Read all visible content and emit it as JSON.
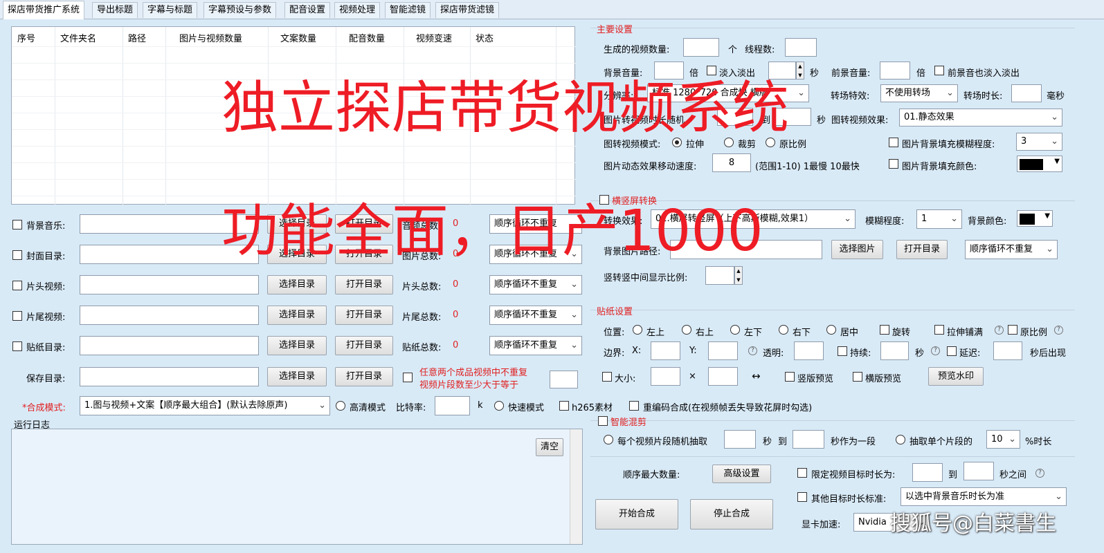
{
  "tabs": [
    "探店带货推广系统",
    "导出标题",
    "字幕与标题",
    "字幕预设与参数",
    "配音设置",
    "视频处理",
    "智能滤镜",
    "探店带货滤镜"
  ],
  "table": {
    "columns": [
      "序号",
      "文件夹名",
      "路径",
      "图片与视频数量",
      "文案数量",
      "配音数量",
      "视频变速",
      "状态"
    ]
  },
  "rows": [
    {
      "label": "背景音乐:",
      "has_cb": true,
      "btn1": "选择目录",
      "btn2": "打开目录",
      "count_label": "音频总数:",
      "count": "0",
      "mode": "顺序循环不重复"
    },
    {
      "label": "封面目录:",
      "has_cb": true,
      "btn1": "选择目录",
      "btn2": "打开目录",
      "count_label": "图片总数:",
      "count": "0",
      "mode": "顺序循环不重复"
    },
    {
      "label": "片头视频:",
      "has_cb": true,
      "btn1": "选择目录",
      "btn2": "打开目录",
      "count_label": "片头总数:",
      "count": "0",
      "mode": "顺序循环不重复"
    },
    {
      "label": "片尾视频:",
      "has_cb": true,
      "btn1": "选择目录",
      "btn2": "打开目录",
      "count_label": "片尾总数:",
      "count": "0",
      "mode": "顺序循环不重复"
    },
    {
      "label": "贴纸目录:",
      "has_cb": true,
      "btn1": "选择目录",
      "btn2": "打开目录",
      "count_label": "贴纸总数:",
      "count": "0",
      "mode": "顺序循环不重复"
    }
  ],
  "save": {
    "label": "保存目录:",
    "btn1": "选择目录",
    "btn2": "打开目录",
    "note1": "任意两个成品视频中不重复",
    "note2": "视频片段数至少大于等于"
  },
  "compose": {
    "label": "*合成模式:",
    "mode": "1.图与视频+文案【顺序最大组合】(默认去除原声)",
    "hd": "高清模式",
    "bitrate": "比特率:",
    "k": "k",
    "fast": "快速模式",
    "h265": "h265素材",
    "reencode": "重编码合成(在视频帧丢失导致花屏时勾选)"
  },
  "log": {
    "title": "运行日志",
    "clear": "清空"
  },
  "main": {
    "title": "主要设置",
    "gen_count": "生成的视频数量:",
    "unit_ge": "个",
    "threads": "线程数:",
    "bg_vol": "背景音量:",
    "bei": "倍",
    "fade": "淡入淡出",
    "sec": "秒",
    "fg_vol": "前景音量:",
    "bei2": "倍",
    "fg_fade": "前景音也淡入淡出",
    "res_label": "分辨率:",
    "res": "标准 1280*720 合成快 横版",
    "trans_label": "转场特效:",
    "trans": "不使用转场",
    "trans_dur": "转场时长:",
    "ms": "毫秒",
    "img_dur": "图片转视频时长随机",
    "to": "到",
    "sec2": "秒",
    "img_fx_label": "图转视频效果:",
    "img_fx": "01.静态效果",
    "img_mode": "图转视频模式:",
    "stretch": "拉伸",
    "crop": "裁剪",
    "orig": "原比例",
    "blur_fill": "图片背景填充模糊程度:",
    "blur_val": "3",
    "speed_label": "图片动态效果移动速度:",
    "speed": "8",
    "speed_note": "(范围1-10) 1最慢 10最快",
    "color_fill": "图片背景填充颜色:"
  },
  "flip": {
    "title": "横竖屏转换",
    "effect_label": "转换效果:",
    "effect": "01.横屏转竖屏（上下高斯模糊,效果1）",
    "blur_label": "模糊程度:",
    "blur": "1",
    "bg_color": "背景颜色:",
    "bg_path": "背景图片路径:",
    "select_img": "选择图片",
    "open_dir": "打开目录",
    "loop": "顺序循环不重复",
    "ratio": "竖转竖中间显示比例:"
  },
  "sticker": {
    "title": "贴纸设置",
    "pos": "位置:",
    "tl": "左上",
    "tr": "右上",
    "bl": "左下",
    "br": "右下",
    "center": "居中",
    "rotate": "旋转",
    "tile": "拉伸铺满",
    "orig": "原比例",
    "margin": "边界:",
    "x": "X:",
    "y": "Y:",
    "alpha": "透明:",
    "dur": "持续:",
    "sec": "秒",
    "delay": "延迟:",
    "after": "秒后出现",
    "size": "大小:",
    "times": "×",
    "arrow": "↔",
    "v_preview": "竖版预览",
    "h_preview": "横版预览",
    "wm_preview": "预览水印"
  },
  "smart": {
    "title": "智能混剪",
    "each": "每个视频片段随机抽取",
    "sec": "秒",
    "to": "到",
    "as_seg": "秒作为一段",
    "single": "抽取单个片段的",
    "pct": "10",
    "pct_label": "%时长"
  },
  "bottom": {
    "max_seq": "顺序最大数量:",
    "advanced": "高级设置",
    "limit": "限定视频目标时长为:",
    "to": "到",
    "between": "秒之间",
    "other": "其他目标时长标准:",
    "other_sel": "以选中背景音乐时长为准",
    "start": "开始合成",
    "stop": "停止合成",
    "gpu": "显卡加速:",
    "gpu_sel": "Nvidia"
  },
  "overlay": {
    "line1": "独立探店带货视频系统",
    "line2": "功能全面，日产1000"
  },
  "watermark": "搜狐号@白菜書生"
}
